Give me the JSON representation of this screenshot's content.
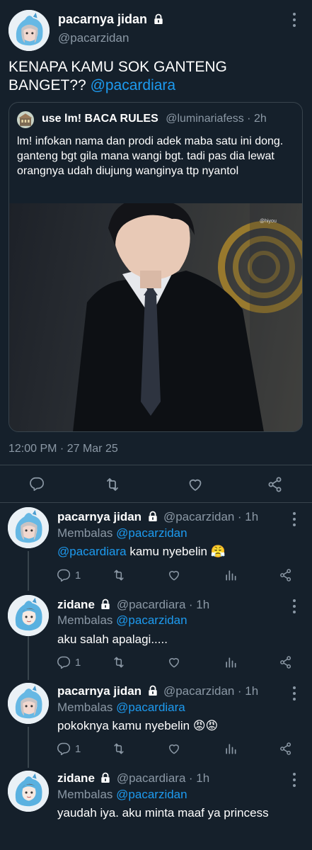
{
  "main_tweet": {
    "display_name": "pacarnya jidan",
    "handle": "@pacarzidan",
    "text": "KENAPA KAMU SOK GANTENG BANGET??",
    "mention": "@pacardiara",
    "timestamp": "12:00 PM · 27 Mar 25"
  },
  "quoted_tweet": {
    "display_name": "use lm! BACA RULES",
    "handle": "@luminariafess",
    "time": "· 2h",
    "text": "lm! infokan nama dan prodi adek maba satu ini dong. ganteng bgt gila mana wangi bgt. tadi pas dia lewat orangnya udah diujung wanginya ttp nyantol",
    "image_watermark": "@hiyou"
  },
  "replies": [
    {
      "display_name": "pacarnya jidan",
      "handle": "@pacarzidan",
      "time": "· 1h",
      "replying_prefix": "Membalas",
      "replying_to": "@pacarzidan",
      "mention": "@pacardiara",
      "text": "kamu nyebelin 😤",
      "reply_count": "1"
    },
    {
      "display_name": "zidane",
      "handle": "@pacardiara",
      "time": "· 1h",
      "replying_prefix": "Membalas",
      "replying_to": "@pacarzidan",
      "text": "aku salah apalagi.....",
      "reply_count": "1"
    },
    {
      "display_name": "pacarnya jidan",
      "handle": "@pacarzidan",
      "time": "· 1h",
      "replying_prefix": "Membalas",
      "replying_to": "@pacardiara",
      "text": "pokoknya kamu nyebelin 😡😡",
      "reply_count": "1"
    },
    {
      "display_name": "zidane",
      "handle": "@pacardiara",
      "time": "· 1h",
      "replying_prefix": "Membalas",
      "replying_to": "@pacarzidan",
      "text": "yaudah iya. aku minta maaf ya princess"
    }
  ],
  "icons": {
    "reply": "reply-icon",
    "retweet": "retweet-icon",
    "like": "like-icon",
    "views": "views-icon",
    "share": "share-icon",
    "more": "more-icon",
    "lock": "lock-icon"
  },
  "colors": {
    "background": "#15202b",
    "accent": "#1d9bf0",
    "muted": "#8b98a5",
    "border": "#38444d"
  }
}
